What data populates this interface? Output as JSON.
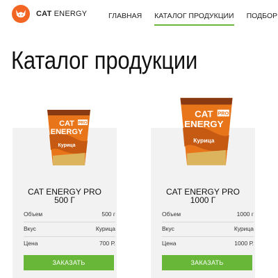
{
  "header": {
    "logo_text_bold": "CAT",
    "logo_text_rest": " ENERGY",
    "nav": [
      {
        "label": "ГЛАВНАЯ"
      },
      {
        "label": "КАТАЛОГ ПРОДУКЦИИ",
        "active": true
      },
      {
        "label": "ПОДБОР ПРОГРАММЫ"
      }
    ]
  },
  "main": {
    "title": "Каталог продукции",
    "products": [
      {
        "name": "CAT ENERGY PRO",
        "size": "500 Г",
        "specs": [
          {
            "label": "Объем",
            "value": "500 г"
          },
          {
            "label": "Вкус",
            "value": "Курица"
          },
          {
            "label": "Цена",
            "value": "700 Р."
          }
        ],
        "button": "ЗАКАЗАТЬ",
        "package_text": {
          "line1": "CAT",
          "line2": "ENERGY",
          "badge": "PRO",
          "flavor": "Курица"
        }
      },
      {
        "name": "CAT ENERGY PRO",
        "size": "1000 Г",
        "specs": [
          {
            "label": "Объем",
            "value": "1000 г"
          },
          {
            "label": "Вкус",
            "value": "Курица"
          },
          {
            "label": "Цена",
            "value": "1000 Р."
          }
        ],
        "button": "ЗАКАЗАТЬ",
        "package_text": {
          "line1": "CAT",
          "line2": "ENERGY",
          "badge": "PRO",
          "flavor": "Курица"
        }
      }
    ]
  },
  "colors": {
    "accent": "#68b738",
    "logo": "#f26522",
    "card_bg": "#f2f2f2",
    "package_orange": "#e8751a"
  },
  "icons": {
    "logo": "cat-logo-icon"
  }
}
